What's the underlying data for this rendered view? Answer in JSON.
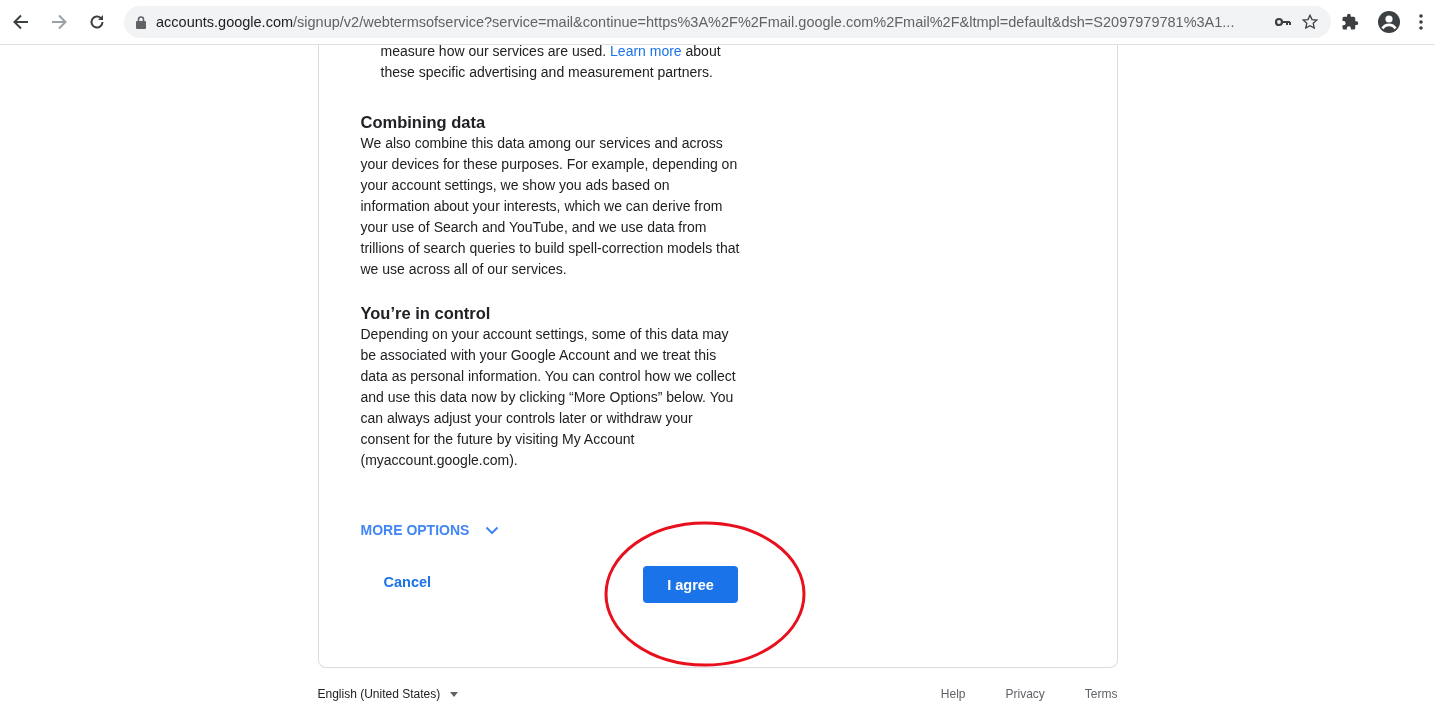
{
  "browser": {
    "address": {
      "host": "accounts.google.com",
      "path": "/signup/v2/webtermsofservice?service=mail&continue=https%3A%2F%2Fmail.google.com%2Fmail%2F&ltmpl=default&dsh=S2097979781%3A1..."
    }
  },
  "card": {
    "intro": {
      "before": "measure how our services are used. ",
      "link": "Learn more",
      "after": " about these specific advertising and measurement partners."
    },
    "sections": [
      {
        "heading": "Combining data",
        "body": "We also combine this data among our services and across your devices for these purposes. For example, depending on your account settings, we show you ads based on information about your interests, which we can derive from your use of Search and YouTube, and we use data from trillions of search queries to build spell-correction models that we use across all of our services."
      },
      {
        "heading": "You’re in control",
        "body": "Depending on your account settings, some of this data may be associated with your Google Account and we treat this data as personal information. You can control how we collect and use this data now by clicking “More Options” below. You can always adjust your controls later or withdraw your consent for the future by visiting My Account (myaccount.google.com)."
      }
    ],
    "more_options": {
      "label": "MORE OPTIONS",
      "expanded": false
    },
    "buttons": {
      "cancel": "Cancel",
      "agree": "I agree"
    }
  },
  "footer": {
    "language": "English (United States)",
    "links": [
      "Help",
      "Privacy",
      "Terms"
    ]
  }
}
